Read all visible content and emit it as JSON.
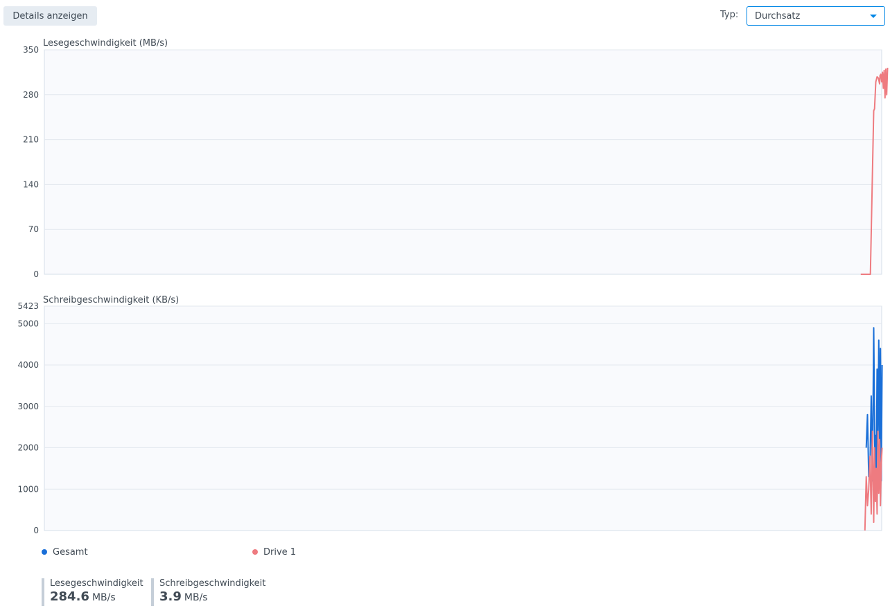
{
  "toolbar": {
    "details_label": "Details anzeigen",
    "type_label": "Typ:",
    "type_value": "Durchsatz"
  },
  "colors": {
    "gesamt": "#1a6fd8",
    "drive1": "#ee7b80",
    "grid": "#e3e8ee",
    "plot_bg": "#f9fafd",
    "border": "#d5dfe9"
  },
  "chart_data": [
    {
      "type": "line",
      "title": "Lesegeschwindigkeit (MB/s)",
      "ylim": [
        0,
        350
      ],
      "yticks": [
        0,
        70,
        140,
        210,
        280,
        350
      ],
      "grid": true,
      "x_range": [
        0,
        200
      ],
      "series": [
        {
          "name": "Drive 1",
          "color": "#ee7b80",
          "points": [
            [
              195,
              0
            ],
            [
              197.3,
              0
            ],
            [
              198.1,
              255
            ],
            [
              198.3,
              258
            ],
            [
              198.6,
              300
            ],
            [
              198.9,
              308
            ],
            [
              199.2,
              306
            ],
            [
              199.5,
              297
            ],
            [
              199.6,
              310
            ],
            [
              199.8,
              312
            ],
            [
              200.0,
              300
            ],
            [
              200.2,
              315
            ],
            [
              200.4,
              290
            ],
            [
              200.6,
              318
            ],
            [
              200.8,
              275
            ],
            [
              201.0,
              320
            ],
            [
              201.2,
              280
            ],
            [
              201.4,
              322
            ]
          ]
        }
      ]
    },
    {
      "type": "line",
      "title": "Schreibgeschwindigkeit (KB/s)",
      "ylim": [
        0,
        5423
      ],
      "yticks": [
        0,
        1000,
        2000,
        3000,
        4000,
        5000,
        5423
      ],
      "grid": true,
      "x_range": [
        0,
        200
      ],
      "series": [
        {
          "name": "Gesamt",
          "color": "#1a6fd8",
          "points": [
            [
              196.3,
              2000
            ],
            [
              196.6,
              2800
            ],
            [
              196.9,
              1300
            ],
            [
              197.2,
              1500
            ],
            [
              197.5,
              3250
            ],
            [
              197.8,
              1200
            ],
            [
              198.1,
              4900
            ],
            [
              198.4,
              1500
            ],
            [
              198.5,
              2300
            ],
            [
              198.7,
              1300
            ],
            [
              198.9,
              3900
            ],
            [
              199.1,
              2200
            ],
            [
              199.3,
              4600
            ],
            [
              199.5,
              2100
            ],
            [
              199.7,
              4400
            ],
            [
              199.9,
              1200
            ],
            [
              200.1,
              4000
            ]
          ]
        },
        {
          "name": "Drive 1",
          "color": "#ee7b80",
          "points": [
            [
              196.0,
              0
            ],
            [
              196.3,
              1300
            ],
            [
              196.6,
              600
            ],
            [
              196.9,
              1000
            ],
            [
              197.2,
              1800
            ],
            [
              197.5,
              400
            ],
            [
              197.8,
              2400
            ],
            [
              198.1,
              200
            ],
            [
              198.3,
              2000
            ],
            [
              198.5,
              700
            ],
            [
              198.7,
              1500
            ],
            [
              198.9,
              400
            ],
            [
              199.1,
              2400
            ],
            [
              199.3,
              900
            ],
            [
              199.5,
              2200
            ],
            [
              199.7,
              600
            ],
            [
              199.9,
              1600
            ],
            [
              200.1,
              2000
            ]
          ]
        }
      ]
    }
  ],
  "legend": [
    {
      "name": "Gesamt",
      "color": "#1a6fd8"
    },
    {
      "name": "Drive 1",
      "color": "#ee7b80"
    }
  ],
  "stats": [
    {
      "label": "Lesegeschwindigkeit",
      "value": "284.6",
      "unit": "MB/s"
    },
    {
      "label": "Schreibgeschwindigkeit",
      "value": "3.9",
      "unit": "MB/s"
    }
  ]
}
